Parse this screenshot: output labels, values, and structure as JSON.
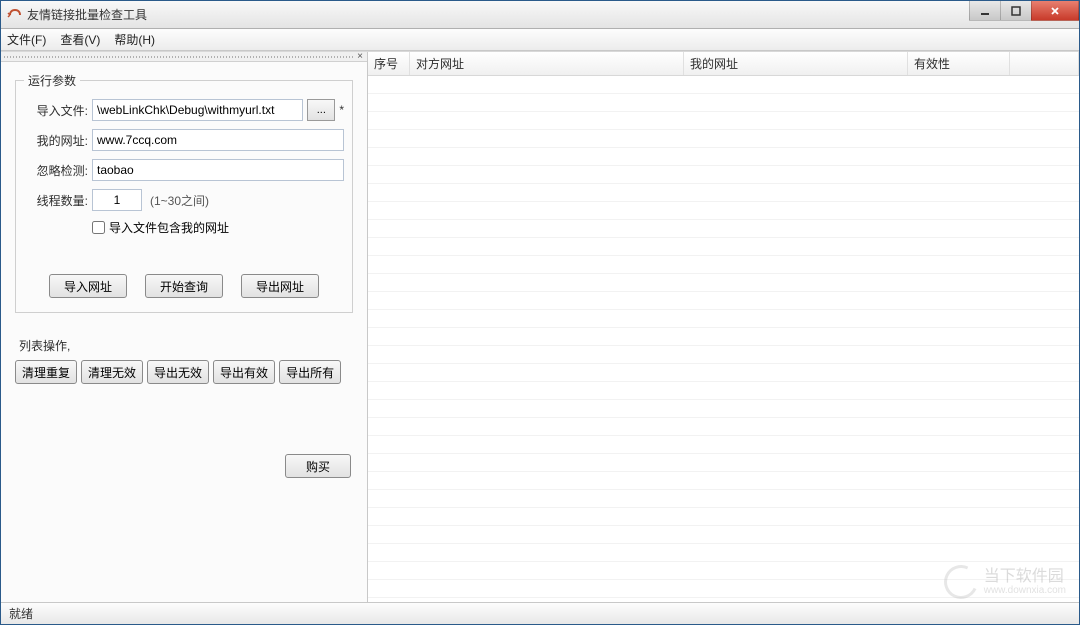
{
  "window": {
    "title": "友情链接批量检查工具"
  },
  "menubar": {
    "file": "文件(F)",
    "view": "查看(V)",
    "help": "帮助(H)"
  },
  "sidebar": {
    "params_legend": "运行参数",
    "import_file_label": "导入文件:",
    "import_file_value": "\\webLinkChk\\Debug\\withmyurl.txt",
    "browse_label": "...",
    "star": "*",
    "my_url_label": "我的网址:",
    "my_url_value": "www.7ccq.com",
    "ignore_label": "忽略检测:",
    "ignore_value": "taobao",
    "thread_label": "线程数量:",
    "thread_value": "1",
    "thread_hint": "(1~30之间)",
    "checkbox_label": "导入文件包含我的网址",
    "btn_import": "导入网址",
    "btn_start": "开始查询",
    "btn_export": "导出网址",
    "list_ops_title": "列表操作,",
    "btn_dedup": "清理重复",
    "btn_clear_invalid": "清理无效",
    "btn_export_invalid": "导出无效",
    "btn_export_valid": "导出有效",
    "btn_export_all": "导出所有",
    "btn_buy": "购买"
  },
  "listview": {
    "columns": {
      "seq": "序号",
      "their_url": "对方网址",
      "my_url": "我的网址",
      "validity": "有效性"
    }
  },
  "statusbar": {
    "text": "就绪"
  },
  "watermark": {
    "name": "当下软件园",
    "url": "www.downxia.com"
  }
}
